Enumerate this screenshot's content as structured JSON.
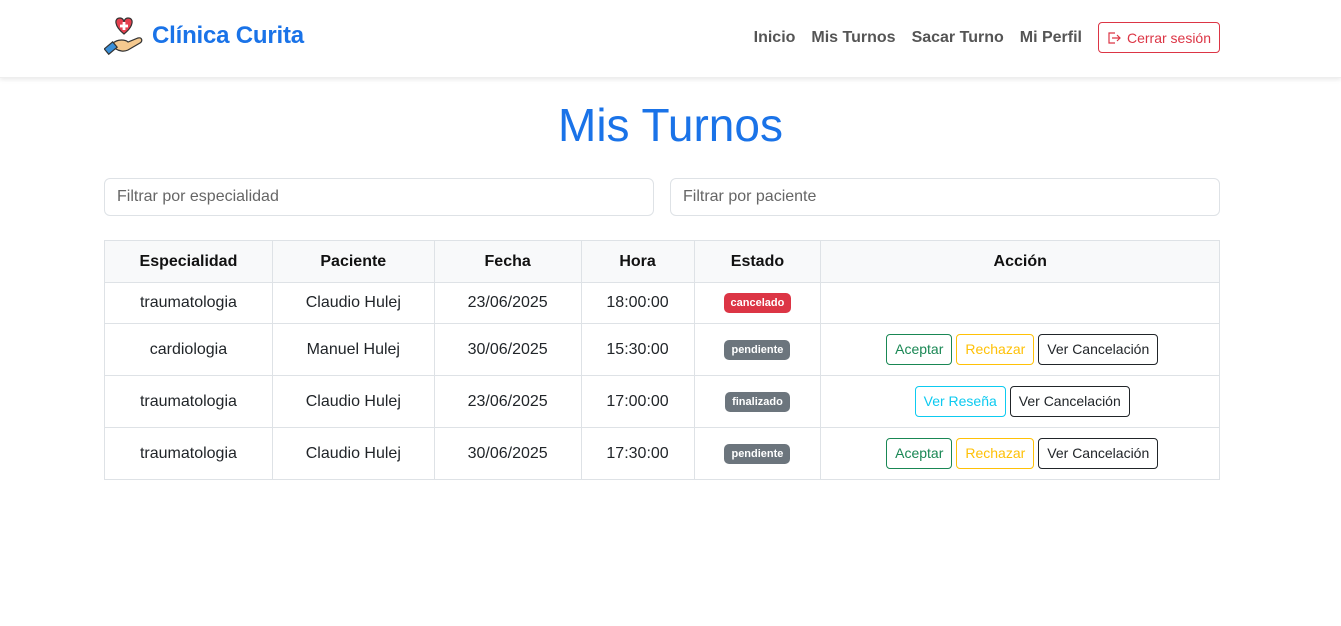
{
  "brand": {
    "name": "Clínica Curita",
    "logo_icon": "heart-hand-logo-icon"
  },
  "nav": {
    "items": [
      "Inicio",
      "Mis Turnos",
      "Sacar Turno",
      "Mi Perfil"
    ],
    "logout_label": "Cerrar sesión",
    "logout_icon": "logout-icon"
  },
  "page": {
    "title": "Mis Turnos"
  },
  "filters": {
    "especialidad_placeholder": "Filtrar por especialidad",
    "paciente_placeholder": "Filtrar por paciente"
  },
  "table": {
    "headers": [
      "Especialidad",
      "Paciente",
      "Fecha",
      "Hora",
      "Estado",
      "Acción"
    ],
    "rows": [
      {
        "especialidad": "traumatologia",
        "paciente": "Claudio Hulej",
        "fecha": "23/06/2025",
        "hora": "18:00:00",
        "estado": "cancelado",
        "acciones": []
      },
      {
        "especialidad": "cardiologia",
        "paciente": "Manuel Hulej",
        "fecha": "30/06/2025",
        "hora": "15:30:00",
        "estado": "pendiente",
        "acciones": [
          "Aceptar",
          "Rechazar",
          "Ver Cancelación"
        ]
      },
      {
        "especialidad": "traumatologia",
        "paciente": "Claudio Hulej",
        "fecha": "23/06/2025",
        "hora": "17:00:00",
        "estado": "finalizado",
        "acciones": [
          "Ver Reseña",
          "Ver Cancelación"
        ]
      },
      {
        "especialidad": "traumatologia",
        "paciente": "Claudio Hulej",
        "fecha": "30/06/2025",
        "hora": "17:30:00",
        "estado": "pendiente",
        "acciones": [
          "Aceptar",
          "Rechazar",
          "Ver Cancelación"
        ]
      }
    ]
  },
  "colors": {
    "primary": "#1a73e8",
    "danger": "#dc3545",
    "success": "#198754",
    "warning": "#ffc107",
    "info": "#0dcaf0",
    "secondary": "#6c757d"
  }
}
